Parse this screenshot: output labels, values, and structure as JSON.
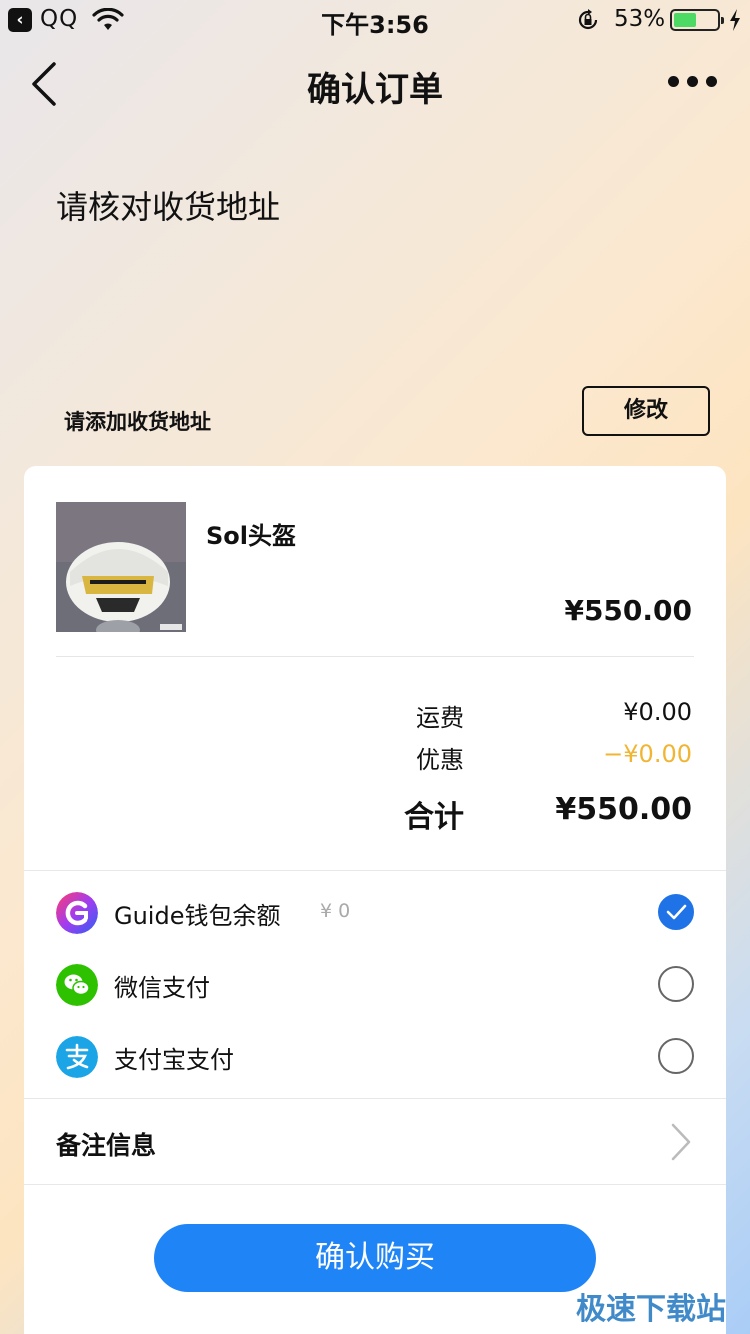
{
  "status_bar": {
    "app": "QQ",
    "time": "下午3:56",
    "battery": "53%",
    "battery_level": 0.53
  },
  "nav": {
    "title": "确认订单"
  },
  "address": {
    "heading": "请核对收货地址",
    "placeholder": "请添加收货地址",
    "modify_label": "修改"
  },
  "product": {
    "name": "Sol头盔",
    "price": "¥550.00"
  },
  "fees": {
    "shipping_label": "运费",
    "shipping_value": "¥0.00",
    "discount_label": "优惠",
    "discount_value": "−¥0.00",
    "total_label": "合计",
    "total_value": "¥550.00"
  },
  "payment": {
    "options": [
      {
        "label": "Guide钱包余额",
        "balance": "¥ 0",
        "icon": "guide-wallet-icon",
        "checked": true
      },
      {
        "label": "微信支付",
        "icon": "wechat-pay-icon",
        "checked": false
      },
      {
        "label": "支付宝支付",
        "icon": "alipay-icon",
        "checked": false
      }
    ]
  },
  "remark": {
    "label": "备注信息"
  },
  "buy_button": "确认购买",
  "watermark": "极速下载站",
  "colors": {
    "primary": "#1f84f6",
    "check": "#1f73e6",
    "discount": "#f1b534",
    "wechat": "#2dc100",
    "alipay": "#1ba5e7"
  }
}
